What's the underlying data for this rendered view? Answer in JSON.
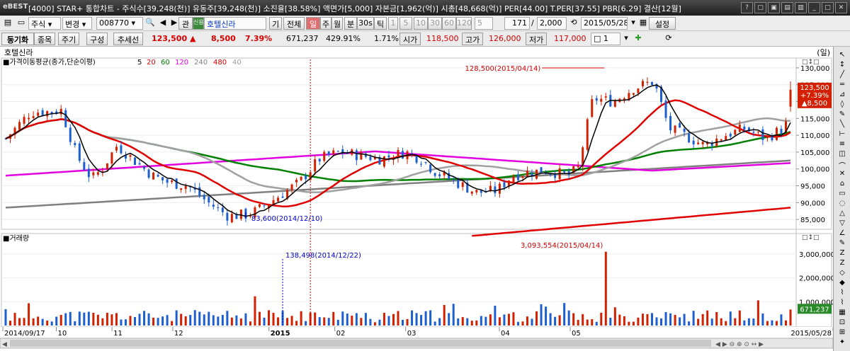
{
  "window": {
    "logo": "eBEST",
    "title": "[4000] STAR+ 통합차트 - 주식수[39,248(천)] 유동주[39,248(천)] 소진율[38.58%] 액면가[5,000] 자본금[1,962(억)] 시총[48,668(억)] PER[44.00] T.PER[37.55] PBR[6.29] 결산[12월]"
  },
  "toolbar": {
    "market": "주식",
    "change": "변경",
    "code": "008770",
    "gwan": "관",
    "code_badge": "신용",
    "name": "호텔신라",
    "gi": "기",
    "all": "전체",
    "periods": [
      "일",
      "주",
      "월",
      "분",
      "30s",
      "틱"
    ],
    "intervals": [
      "1",
      "5",
      "10",
      "30",
      "60",
      "120"
    ],
    "interval_input": "5",
    "count": "171",
    "total": "2,000",
    "date": "2015/05/28",
    "settings": "설정"
  },
  "toolbar2": {
    "sync": "동기화",
    "items": "종목",
    "cycle": "주기",
    "compose": "구성",
    "add": "추세선",
    "price": "123,500",
    "arrow": "▲",
    "change": "8,500",
    "change_pct": "7.39%",
    "volume": "671,237",
    "vol_pct": "429.91%",
    "turnover": "1.71%",
    "open_label": "시가",
    "open": "118,500",
    "high_label": "고가",
    "high": "126,000",
    "low_label": "저가",
    "low": "117,000",
    "spin": "1"
  },
  "stock_name": "호텔신라",
  "unit": "(일)",
  "indicator": {
    "label": "가격이동평균(종가,단순이평)",
    "periods": [
      {
        "p": "5",
        "color": "#000000"
      },
      {
        "p": "20",
        "color": "#e00000"
      },
      {
        "p": "60",
        "color": "#008000"
      },
      {
        "p": "120",
        "color": "#e000e0"
      },
      {
        "p": "240",
        "color": "#808080"
      },
      {
        "p": "480",
        "color": "#e00000"
      },
      {
        "p": "40",
        "color": "#a0a0a0"
      }
    ]
  },
  "volume_label": "거래량",
  "annotations": {
    "high": "128,500(2015/04/14)",
    "low": "83,600(2014/12/10)",
    "vol_low": "138,498(2014/12/22)",
    "vol_high": "3,093,554(2015/04/14)"
  },
  "price_axis": [
    "130,000",
    "125,000",
    "120,000",
    "115,000",
    "110,000",
    "105,000",
    "100,000",
    "95,000",
    "90,000",
    "85,000"
  ],
  "volume_axis": [
    "3,000,000",
    "2,000,000",
    "1,000,000"
  ],
  "current_box": [
    "123,500",
    "+7.39%",
    "▲8,500"
  ],
  "volume_box": "671,237",
  "date_axis": [
    "2014/09/17",
    "10",
    "11",
    "12",
    "2015",
    "02",
    "03",
    "04",
    "05",
    "2015/05/28"
  ],
  "colors": {
    "up": "#d22000",
    "down": "#1e5fd0",
    "ma5": "#000000",
    "ma20": "#e00000",
    "ma60": "#008000",
    "ma120": "#e000e0",
    "ma240": "#808080",
    "ma480": "#e00000",
    "ma40": "#a0a0a0"
  },
  "chart_data": {
    "type": "candlestick",
    "xlabel": "",
    "ylabel": "",
    "ylim": [
      82500,
      132500
    ],
    "volume_ylim": [
      0,
      3500000
    ],
    "series": [
      {
        "name": "Price",
        "ohlc": "daily",
        "count": 171
      },
      {
        "name": "Volume"
      }
    ],
    "range": [
      "2014/09/17",
      "2015/05/28"
    ],
    "last": {
      "open": 118500,
      "high": 126000,
      "low": 117000,
      "close": 123500,
      "volume": 671237
    },
    "extremes": {
      "high": 128500,
      "high_date": "2015/04/14",
      "low": 83600,
      "low_date": "2014/12/10",
      "vol_high": 3093554,
      "vol_high_date": "2015/04/14",
      "vol_low": 138498,
      "vol_low_date": "2014/12/22"
    }
  }
}
